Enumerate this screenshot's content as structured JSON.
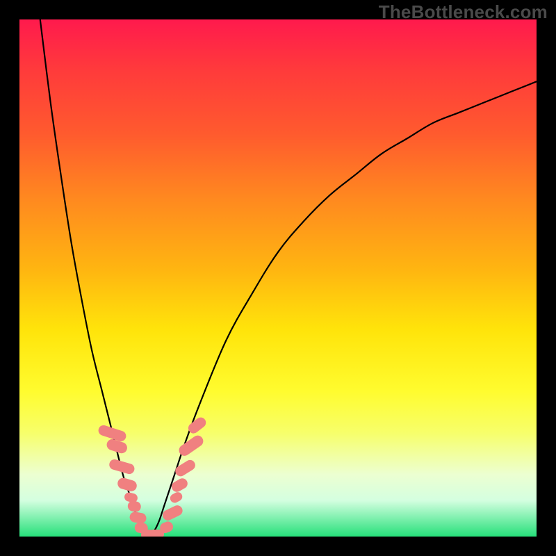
{
  "watermark": "TheBottleneck.com",
  "colors": {
    "frame": "#000000",
    "curve": "#000000",
    "marker_fill": "#f08080",
    "gradient_top": "#ff1a4d",
    "gradient_bottom": "#26e07a"
  },
  "chart_data": {
    "type": "line",
    "title": "",
    "xlabel": "",
    "ylabel": "",
    "xlim": [
      0,
      100
    ],
    "ylim": [
      0,
      100
    ],
    "series": [
      {
        "name": "left-curve",
        "x": [
          4,
          6,
          8,
          10,
          12,
          14,
          16,
          18,
          20,
          21,
          22,
          23,
          24,
          25
        ],
        "y": [
          100,
          84,
          70,
          57,
          46,
          36,
          28,
          20,
          12,
          9,
          6,
          3,
          1,
          0
        ]
      },
      {
        "name": "right-curve",
        "x": [
          25,
          26,
          27,
          28,
          30,
          32,
          35,
          40,
          45,
          50,
          55,
          60,
          65,
          70,
          75,
          80,
          85,
          90,
          95,
          100
        ],
        "y": [
          0,
          1,
          3,
          6,
          12,
          18,
          26,
          38,
          47,
          55,
          61,
          66,
          70,
          74,
          77,
          80,
          82,
          84,
          86,
          88
        ]
      }
    ],
    "markers": {
      "name": "marker-cluster",
      "description": "salmon bead markers along both curve arms near valley",
      "points": [
        {
          "x": 18.0,
          "y": 20.0,
          "w": 2.0,
          "h": 5.5,
          "angle": 72
        },
        {
          "x": 18.8,
          "y": 17.5,
          "w": 2.2,
          "h": 4.0,
          "angle": 72
        },
        {
          "x": 19.8,
          "y": 13.5,
          "w": 2.0,
          "h": 5.0,
          "angle": 74
        },
        {
          "x": 20.8,
          "y": 10.0,
          "w": 2.2,
          "h": 3.8,
          "angle": 74
        },
        {
          "x": 21.6,
          "y": 7.6,
          "w": 1.8,
          "h": 2.6,
          "angle": 76
        },
        {
          "x": 22.2,
          "y": 5.8,
          "w": 2.0,
          "h": 2.6,
          "angle": 78
        },
        {
          "x": 22.9,
          "y": 3.6,
          "w": 2.0,
          "h": 3.2,
          "angle": 80
        },
        {
          "x": 23.6,
          "y": 1.7,
          "w": 2.0,
          "h": 2.6,
          "angle": 82
        },
        {
          "x": 24.8,
          "y": 0.3,
          "w": 2.6,
          "h": 2.0,
          "angle": 0
        },
        {
          "x": 26.5,
          "y": 0.5,
          "w": 3.0,
          "h": 1.8,
          "angle": 0
        },
        {
          "x": 28.4,
          "y": 1.8,
          "w": 2.0,
          "h": 2.6,
          "angle": -68
        },
        {
          "x": 29.6,
          "y": 4.6,
          "w": 2.0,
          "h": 4.0,
          "angle": -64
        },
        {
          "x": 30.3,
          "y": 7.6,
          "w": 1.8,
          "h": 2.4,
          "angle": -62
        },
        {
          "x": 31.0,
          "y": 10.0,
          "w": 2.0,
          "h": 3.2,
          "angle": -60
        },
        {
          "x": 32.0,
          "y": 13.2,
          "w": 2.0,
          "h": 4.2,
          "angle": -58
        },
        {
          "x": 33.2,
          "y": 17.5,
          "w": 2.2,
          "h": 5.2,
          "angle": -55
        },
        {
          "x": 34.3,
          "y": 21.5,
          "w": 2.0,
          "h": 3.8,
          "angle": -52
        }
      ]
    }
  }
}
